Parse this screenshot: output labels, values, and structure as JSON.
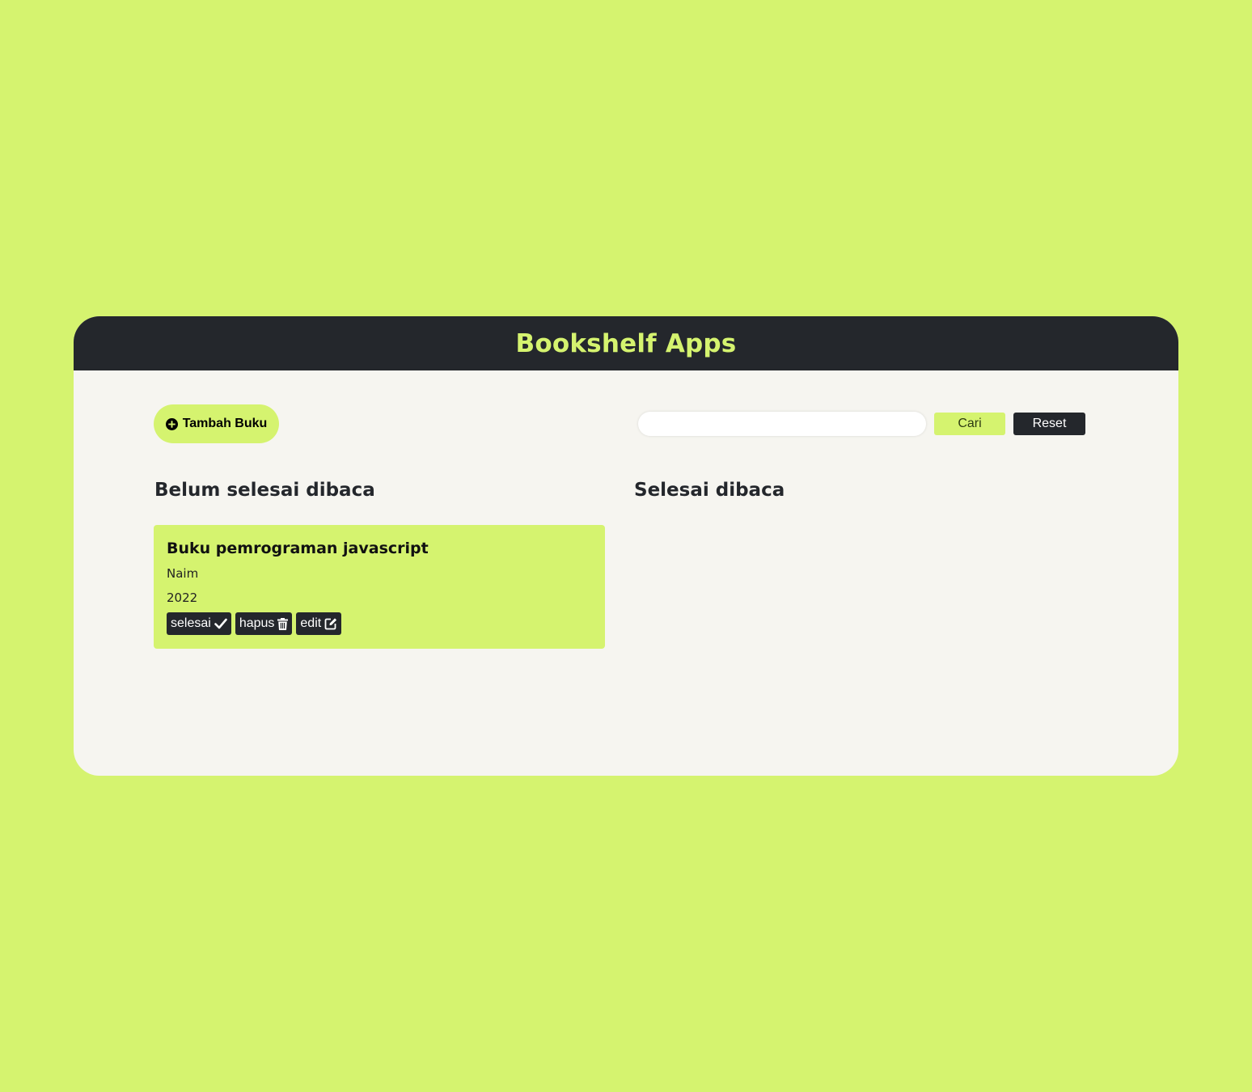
{
  "header": {
    "title": "Bookshelf Apps"
  },
  "toolbar": {
    "add_label": "Tambah Buku",
    "search_placeholder": "",
    "search_value": "",
    "search_label": "Cari",
    "reset_label": "Reset"
  },
  "shelves": {
    "unread_heading": "Belum selesai dibaca",
    "read_heading": "Selesai dibaca"
  },
  "books": [
    {
      "title": "Buku pemrograman javascript",
      "author": "Naim",
      "year": "2022",
      "actions": {
        "finish_label": "selesai",
        "delete_label": "hapus",
        "edit_label": "edit"
      }
    }
  ],
  "icons": {
    "add": "plus-circle-icon",
    "finish": "check-icon",
    "delete": "trash-icon",
    "edit": "edit-icon"
  },
  "colors": {
    "accent": "#d5f36f",
    "dark": "#24272c",
    "panel": "#f6f5f0"
  }
}
